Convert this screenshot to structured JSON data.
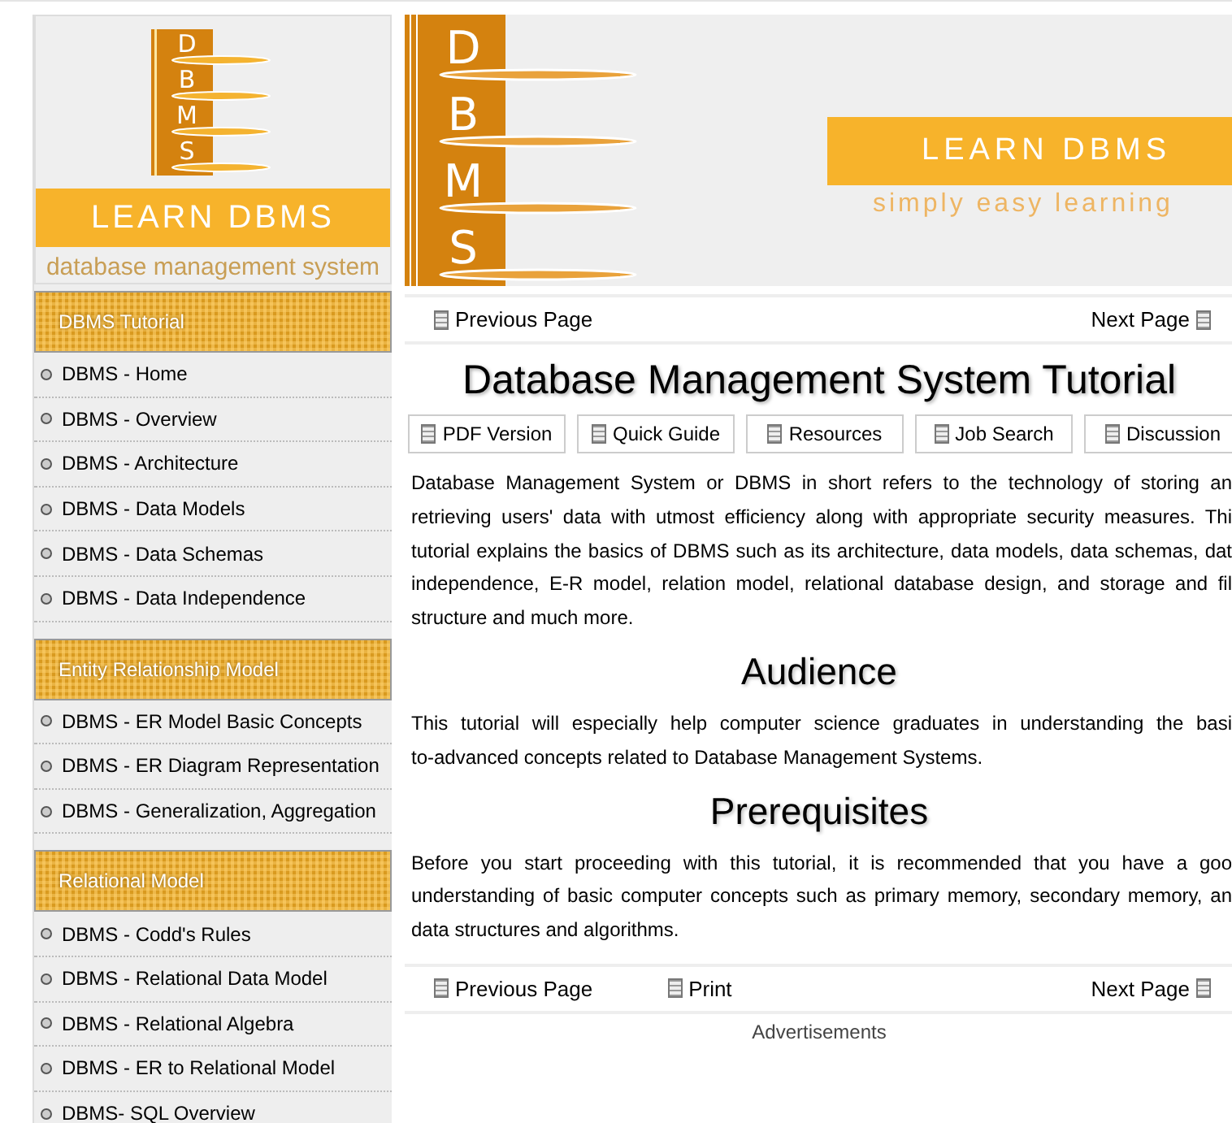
{
  "logo": {
    "letters": [
      "D",
      "B",
      "M",
      "S"
    ],
    "title": "LEARN DBMS",
    "subtitle": "database management system"
  },
  "banner": {
    "letters": [
      "D",
      "B",
      "M",
      "S"
    ],
    "title": "LEARN DBMS",
    "tagline": "simply easy learning"
  },
  "sidebar": {
    "sections": [
      {
        "heading": "DBMS Tutorial",
        "items": [
          "DBMS - Home",
          "DBMS - Overview",
          "DBMS - Architecture",
          "DBMS - Data Models",
          "DBMS - Data Schemas",
          "DBMS - Data Independence"
        ]
      },
      {
        "heading": "Entity Relationship Model",
        "items": [
          "DBMS - ER Model Basic Concepts",
          "DBMS - ER Diagram Representation",
          "DBMS - Generalization, Aggregation"
        ]
      },
      {
        "heading": "Relational Model",
        "items": [
          "DBMS - Codd's Rules",
          "DBMS - Relational Data Model",
          "DBMS - Relational Algebra",
          "DBMS - ER to Relational Model",
          "DBMS- SQL Overview"
        ]
      }
    ]
  },
  "nav_top": {
    "previous": "Previous Page",
    "next": "Next Page"
  },
  "title": "Database Management System Tutorial",
  "tool_buttons": [
    "PDF Version",
    "Quick Guide",
    "Resources",
    "Job Search",
    "Discussion"
  ],
  "content": [
    {
      "kind": "paragraph",
      "lines": [
        "Database Management System or DBMS in short refers to the technology of storing an",
        "retrieving users' data with utmost efficiency along with appropriate security measures. Thi",
        "tutorial explains the basics of DBMS such as its architecture, data models, data schemas, dat",
        "independence, E-R model, relation model, relational database design, and storage and fil",
        "structure and much more."
      ]
    },
    {
      "kind": "heading",
      "text": "Audience"
    },
    {
      "kind": "paragraph",
      "lines": [
        "This tutorial will especially help computer science graduates in understanding the basi",
        "to-advanced concepts related to Database Management Systems."
      ]
    },
    {
      "kind": "heading",
      "text": "Prerequisites"
    },
    {
      "kind": "paragraph",
      "lines": [
        "Before you start proceeding with this tutorial, it is recommended that you have a goo",
        "understanding of basic computer concepts such as primary memory, secondary memory, an",
        "data structures and algorithms."
      ]
    }
  ],
  "nav_bottom": {
    "previous": "Previous Page",
    "print": "Print",
    "next": "Next Page"
  },
  "ads_label": "Advertisements"
}
